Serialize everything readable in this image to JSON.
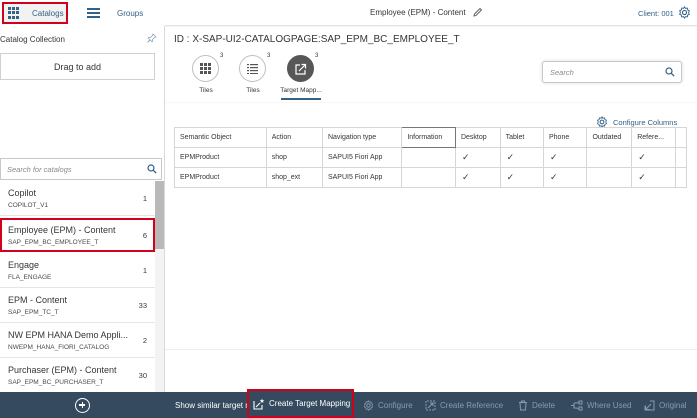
{
  "left": {
    "tabs": {
      "catalogs_label": "Catalogs",
      "groups_label": "Groups"
    },
    "catalog_collection_title": "Catalog Collection",
    "drag_to_add": "Drag to add",
    "search_placeholder": "Search for catalogs",
    "catalogs": [
      {
        "title": "Copilot",
        "id": "COPILOT_V1",
        "count": "1"
      },
      {
        "title": "Employee (EPM) - Content",
        "id": "SAP_EPM_BC_EMPLOYEE_T",
        "count": "6",
        "selected": true
      },
      {
        "title": "Engage",
        "id": "FLA_ENGAGE",
        "count": "1"
      },
      {
        "title": "EPM - Content",
        "id": "SAP_EPM_TC_T",
        "count": "33"
      },
      {
        "title": "NW EPM HANA Demo Appli...",
        "id": "NWEPM_HANA_FIORI_CATALOG",
        "count": "2"
      },
      {
        "title": "Purchaser (EPM) - Content",
        "id": "SAP_EPM_BC_PURCHASER_T",
        "count": "30"
      }
    ]
  },
  "shell": {
    "title": "Employee (EPM) - Content",
    "client": "Client: 001"
  },
  "object": {
    "title": "ID : X-SAP-UI2-CATALOGPAGE:SAP_EPM_BC_EMPLOYEE_T",
    "search_placeholder": "Search",
    "tabs": [
      {
        "label": "Tiles",
        "count": "3",
        "icon": "grid-icon"
      },
      {
        "label": "Tiles",
        "count": "3",
        "icon": "list-icon"
      },
      {
        "label": "Target Mapp...",
        "count": "3",
        "icon": "share-icon",
        "active": true
      }
    ]
  },
  "table": {
    "configure_columns": "Configure Columns",
    "columns": [
      "Semantic Object",
      "Action",
      "Navigation type",
      "Information",
      "Desktop",
      "Tablet",
      "Phone",
      "Outdated",
      "Refere..."
    ],
    "rows": [
      {
        "semantic_object": "EPMProduct",
        "action": "shop",
        "navigation_type": "SAPUI5 Fiori App",
        "information": "",
        "desktop": "✓",
        "tablet": "✓",
        "phone": "✓",
        "outdated": "",
        "reference": "✓"
      },
      {
        "semantic_object": "EPMProduct",
        "action": "shop_ext",
        "navigation_type": "SAPUI5 Fiori App",
        "information": "",
        "desktop": "✓",
        "tablet": "✓",
        "phone": "✓",
        "outdated": "",
        "reference": "✓"
      }
    ]
  },
  "footer": {
    "show_similar": "Show similar target m",
    "create_target_mapping": "Create Target Mapping",
    "configure": "Configure",
    "create_reference": "Create Reference",
    "delete": "Delete",
    "where_used": "Where Used",
    "original": "Original"
  },
  "colors": {
    "brand": "#346187",
    "footer_bg": "#354a5f",
    "highlight": "#d0021b"
  }
}
